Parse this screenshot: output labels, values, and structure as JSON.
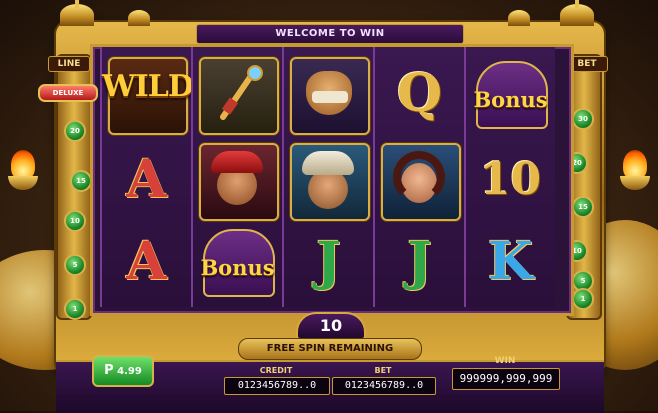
{
  "title_bar": "WELCOME TO WIN",
  "side": {
    "line_label": "LINE",
    "bet_label": "BET",
    "left_values": [
      "20",
      "15",
      "10",
      "5",
      "1"
    ],
    "right_values": [
      "30",
      "20",
      "15",
      "10",
      "5",
      "1"
    ]
  },
  "reels": {
    "reel1": {
      "top": "WILD",
      "deluxe": "DELUXE",
      "mid": "A",
      "bot": "A"
    },
    "reel2": {
      "top": "Staff",
      "mid": "Vizier",
      "bot": "Bonus"
    },
    "reel3": {
      "top": "Camel",
      "mid": "Prince",
      "bot": "J"
    },
    "reel4": {
      "top": "Q",
      "mid": "Princess",
      "bot": "J"
    },
    "reel5": {
      "top": "Bonus",
      "mid": "10",
      "bot": "K"
    }
  },
  "free_spins": {
    "count": "10",
    "label": "FREE SPIN REMAINING"
  },
  "balance_button": {
    "prefix": "P",
    "value": "4.99"
  },
  "credit": {
    "label": "CREDIT",
    "value": "0123456789..0"
  },
  "bet": {
    "label": "BET",
    "value": "0123456789..0"
  },
  "win": {
    "label": "WIN",
    "value": "999999,999,999"
  },
  "colors": {
    "gold": "#d9ae48",
    "purple": "#2a1238",
    "green": "#1e8a2a"
  }
}
